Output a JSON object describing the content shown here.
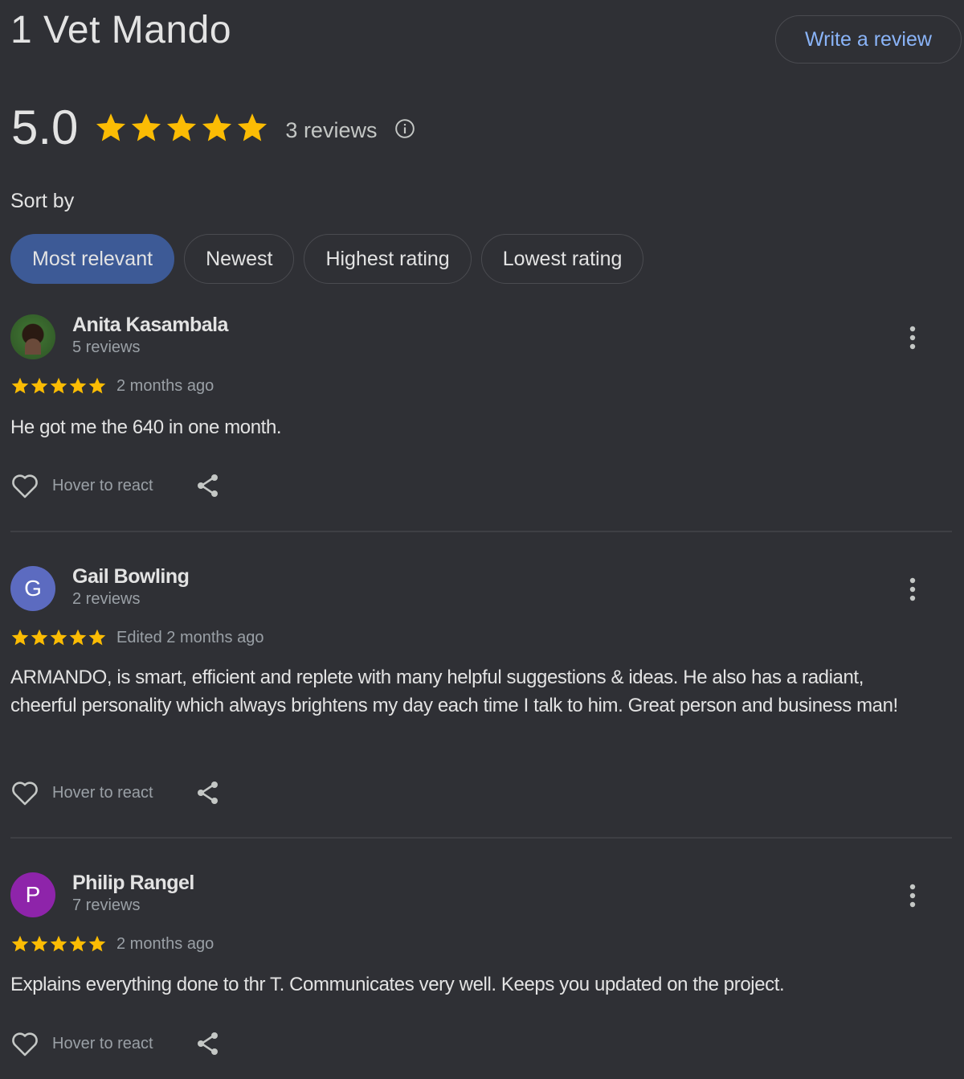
{
  "place": {
    "title": "1 Vet Mando",
    "write_review_label": "Write a review",
    "score": "5.0",
    "star_rating": 5,
    "review_count": "3 reviews"
  },
  "colors": {
    "background": "#2f3035",
    "star": "#fbbc04",
    "link": "#8ab4f8",
    "active_chip": "#3d5a96"
  },
  "sort": {
    "label": "Sort by",
    "options": [
      "Most relevant",
      "Newest",
      "Highest rating",
      "Lowest rating"
    ],
    "selected": "Most relevant"
  },
  "reviews": [
    {
      "name": "Anita Kasambala",
      "count": "5 reviews",
      "avatar": "photo",
      "stars": 5,
      "date": "2 months ago",
      "text": "He got me the 640 in one month.",
      "react_label": "Hover to react"
    },
    {
      "name": "Gail Bowling",
      "count": "2 reviews",
      "avatar": "G",
      "avatar_color": "#5c6bc0",
      "stars": 5,
      "date": "Edited 2 months ago",
      "text": "ARMANDO, is smart, efficient and replete with many helpful suggestions & ideas. He also has a radiant, cheerful personality which always brightens my day each time I talk to him. Great person and business man!",
      "react_label": "Hover to react"
    },
    {
      "name": "Philip Rangel",
      "count": "7 reviews",
      "avatar": "P",
      "avatar_color": "#8e24aa",
      "stars": 5,
      "date": "2 months ago",
      "text": "Explains everything done to thr T. Communicates very well. Keeps you updated on the project.",
      "react_label": "Hover to react"
    }
  ],
  "icons": {
    "star": "star-icon",
    "info": "info-icon",
    "more": "more-vert-icon",
    "heart": "heart-outline-icon",
    "share": "share-icon"
  }
}
